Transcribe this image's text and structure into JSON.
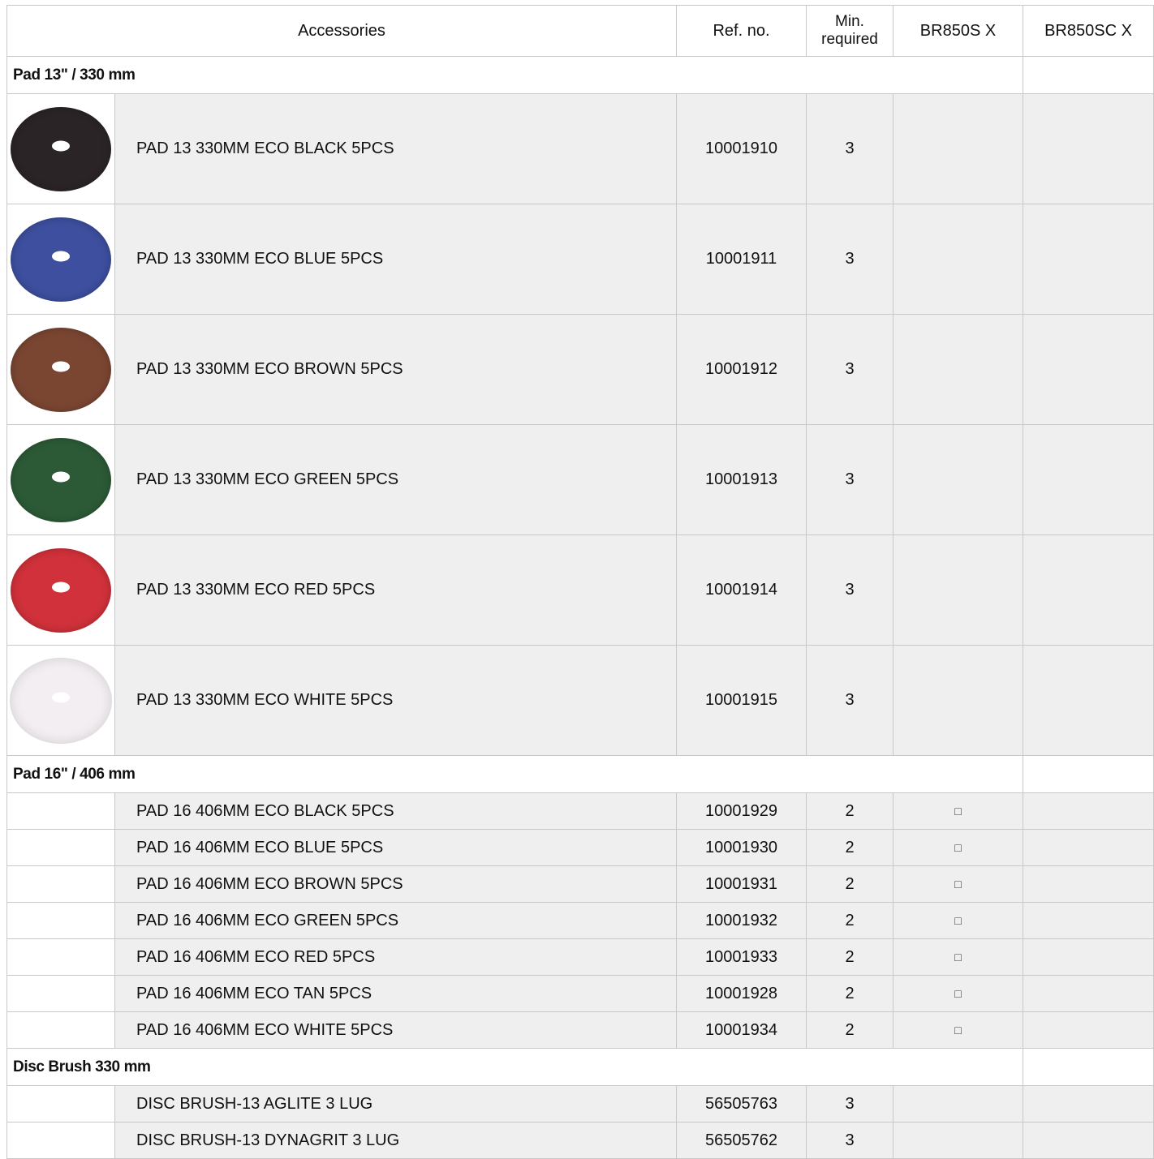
{
  "header": {
    "accessories": "Accessories",
    "ref_no": "Ref. no.",
    "min_required": "Min.\nrequired",
    "model_a": "BR850S X",
    "model_b": "BR850SC X"
  },
  "sections": [
    {
      "title": "Pad 13\" / 330 mm",
      "items": [
        {
          "name": "PAD 13 330MM  ECO BLACK 5PCS",
          "ref": "10001910",
          "min": "3",
          "pad_color": "#2b2426"
        },
        {
          "name": "PAD 13 330MM  ECO BLUE 5PCS",
          "ref": "10001911",
          "min": "3",
          "pad_color": "#3d4f9e"
        },
        {
          "name": "PAD 13 330MM  ECO BROWN 5PCS",
          "ref": "10001912",
          "min": "3",
          "pad_color": "#7a4632"
        },
        {
          "name": "PAD 13 330MM  ECO GREEN 5PCS",
          "ref": "10001913",
          "min": "3",
          "pad_color": "#2c5a36"
        },
        {
          "name": "PAD 13 330MM  ECO RED 5PCS",
          "ref": "10001914",
          "min": "3",
          "pad_color": "#d0313a"
        },
        {
          "name": "PAD 13 330MM  ECO WHITE 5PCS",
          "ref": "10001915",
          "min": "3",
          "pad_color": "#f2eef2"
        }
      ]
    },
    {
      "title": "Pad 16\" / 406 mm",
      "items": [
        {
          "name": "PAD 16 406MM  ECO BLACK 5PCS",
          "ref": "10001929",
          "min": "2",
          "mark": "□"
        },
        {
          "name": "PAD 16 406MM  ECO BLUE 5PCS",
          "ref": "10001930",
          "min": "2",
          "mark": "□"
        },
        {
          "name": "PAD 16 406MM  ECO BROWN 5PCS",
          "ref": "10001931",
          "min": "2",
          "mark": "□"
        },
        {
          "name": "PAD 16 406MM  ECO GREEN 5PCS",
          "ref": "10001932",
          "min": "2",
          "mark": "□"
        },
        {
          "name": "PAD 16 406MM  ECO RED 5PCS",
          "ref": "10001933",
          "min": "2",
          "mark": "□"
        },
        {
          "name": "PAD 16 406MM  ECO TAN 5PCS",
          "ref": "10001928",
          "min": "2",
          "mark": "□"
        },
        {
          "name": "PAD 16 406MM  ECO WHITE 5PCS",
          "ref": "10001934",
          "min": "2",
          "mark": "□"
        }
      ]
    },
    {
      "title": "Disc Brush 330 mm",
      "items": [
        {
          "name": "DISC BRUSH-13 AGLITE 3 LUG",
          "ref": "56505763",
          "min": "3"
        },
        {
          "name": "DISC BRUSH-13 DYNAGRIT 3 LUG",
          "ref": "56505762",
          "min": "3"
        }
      ]
    }
  ]
}
